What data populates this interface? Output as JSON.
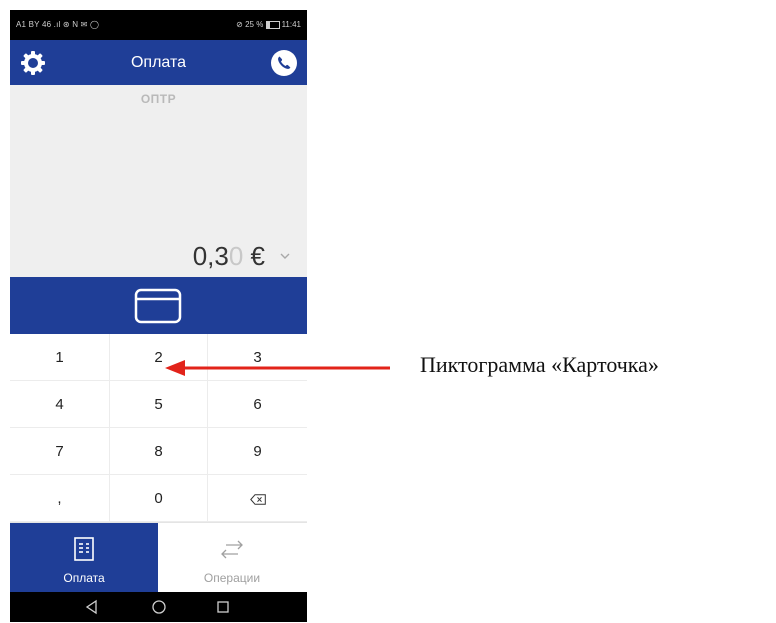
{
  "status_bar": {
    "left": "A1 BY 46 .ıl ⊛ N ✉ ◯",
    "right": "⊘ 25 % ",
    "time": "11:41"
  },
  "app_bar": {
    "title": "Оплата",
    "left_icon": "gear-icon",
    "right_icon": "phone-icon"
  },
  "amount_area": {
    "merchant": "ОПТР",
    "amount_main": "0,3",
    "amount_dim": "0",
    "currency": " €"
  },
  "pay_bar": {
    "icon": "card-icon"
  },
  "keypad": {
    "keys": [
      "1",
      "2",
      "3",
      "4",
      "5",
      "6",
      "7",
      "8",
      "9",
      ",",
      "0",
      "backspace"
    ]
  },
  "bottom_nav": {
    "tabs": [
      {
        "label": "Оплата",
        "icon": "receipt-icon",
        "active": true
      },
      {
        "label": "Операции",
        "icon": "exchange-arrows-icon",
        "active": false
      }
    ]
  },
  "annotation": {
    "text": "Пиктограмма «Карточка»"
  },
  "colors": {
    "primary": "#1f3e97",
    "amount_bg": "#efefef",
    "arrow": "#e2231a"
  }
}
